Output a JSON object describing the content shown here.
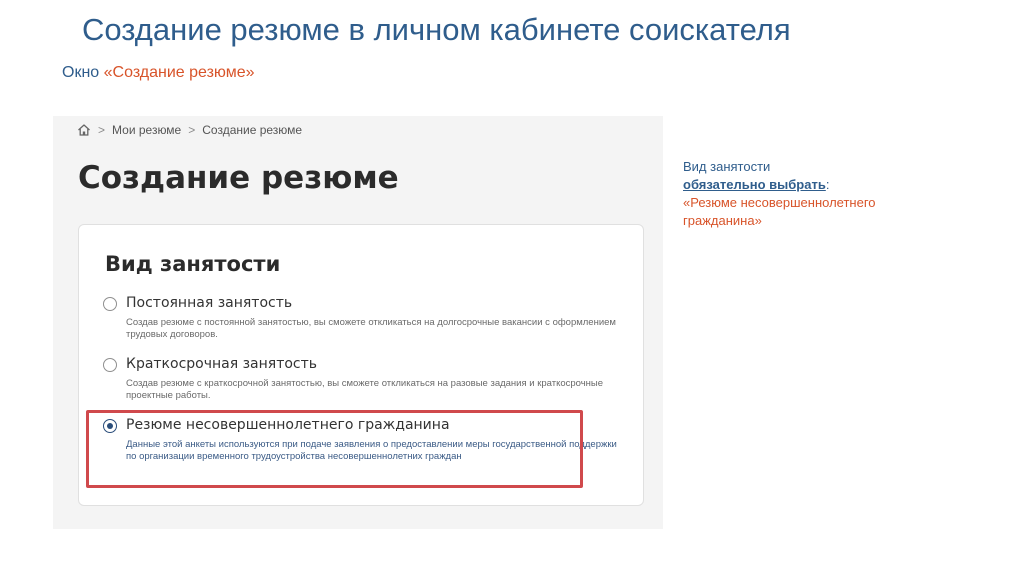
{
  "slide": {
    "title": "Создание резюме в личном кабинете соискателя",
    "subtitle_lead": "Окно",
    "subtitle_accent": "«Создание резюме»"
  },
  "breadcrumb": {
    "items": [
      "Мои резюме",
      "Создание резюме"
    ],
    "separator": ">"
  },
  "page": {
    "heading": "Создание резюме"
  },
  "employment": {
    "title": "Вид занятости",
    "selected": "Резюме несовершеннолетнего гражданина",
    "options": [
      {
        "label": "Постоянная занятость",
        "description": "Создав резюме с постоянной занятостью, вы сможете откликаться на долгосрочные вакансии с оформлением трудовых договоров."
      },
      {
        "label": "Краткосрочная занятость",
        "description": "Создав резюме с краткосрочной занятостью, вы сможете откликаться на разовые задания и краткосрочные проектные работы."
      },
      {
        "label": "Резюме несовершеннолетнего гражданина",
        "description": "Данные этой анкеты используются при подаче заявления о предоставлении меры государственной поддержки по организации временного трудоустройства несовершеннолетних граждан"
      }
    ]
  },
  "note": {
    "line1": "Вид занятости",
    "line2_emphasis": "обязательно выбрать",
    "line2_colon": ":",
    "line3": "«Резюме несовершеннолетнего гражданина»"
  },
  "colors": {
    "title_blue": "#2f5d8c",
    "accent_orange": "#d8542a",
    "highlight_red": "#d0494c",
    "radio_selected": "#2a4d7a"
  }
}
